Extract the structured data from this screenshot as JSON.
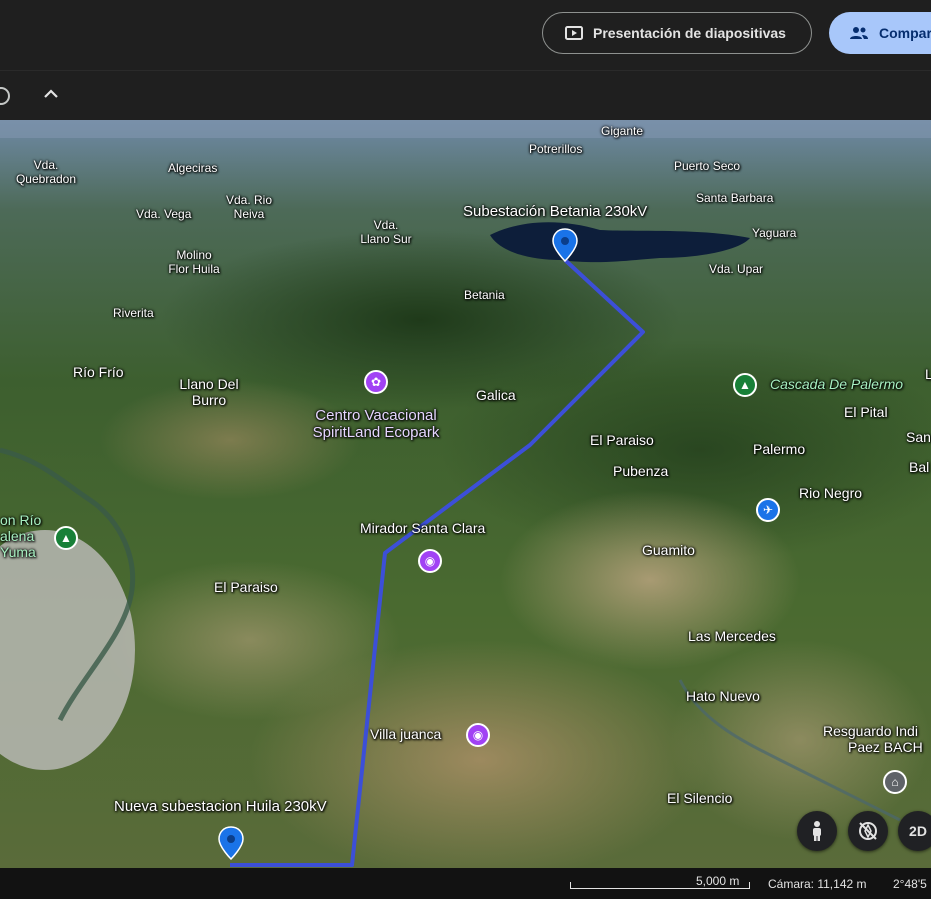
{
  "header": {
    "slideshow_label": "Presentación de diapositivas",
    "share_label": "Compar"
  },
  "map": {
    "route_color": "#3c4fd8",
    "places": {
      "gigante": "Gigante",
      "potrerillos": "Potrerillos",
      "puerto_seco": "Puerto Seco",
      "vda_quebradon_1": "Vda.",
      "vda_quebradon_2": "Quebradon",
      "algeciras": "Algeciras",
      "vda_vega": "Vda. Vega",
      "vda_rio_neiva_1": "Vda. Rio",
      "vda_rio_neiva_2": "Neiva",
      "vda_llano_sur_1": "Vda.",
      "vda_llano_sur_2": "Llano Sur",
      "santa_barbara": "Santa Barbara",
      "yaguara": "Yaguara",
      "molino_1": "Molino",
      "molino_2": "Flor Huila",
      "vda_upar": "Vda. Upar",
      "betania": "Betania",
      "riverita": "Riverita",
      "rio_frio": "Río Frío",
      "llano_del_burro_1": "Llano Del",
      "llano_del_burro_2": "Burro",
      "galica": "Galica",
      "el_pital": "El Pital",
      "el_paraiso_east": "El Paraiso",
      "pubenza": "Pubenza",
      "palermo": "Palermo",
      "rio_negro": "Rio Negro",
      "san_frag": "San",
      "bal_frag": "Bal",
      "guamito": "Guamito",
      "el_paraiso_west": "El Paraiso",
      "las_mercedes": "Las Mercedes",
      "hato_nuevo": "Hato Nuevo",
      "el_silencio": "El Silencio",
      "resguardo_1": "Resguardo Indi",
      "resguardo_2": "Paez BACH",
      "rio_frag_1": "on Río",
      "rio_frag_2": "alena",
      "rio_frag_3": "Yuma",
      "l_frag": "L"
    },
    "pins": {
      "betania_sub": "Subestación Betania 230kV",
      "huila_sub": "Nueva subestacion Huila 230kV"
    },
    "pois": {
      "spiritland_1": "Centro Vacacional",
      "spiritland_2": "SpiritLand Ecopark",
      "mirador": "Mirador Santa Clara",
      "villa_juanca": "Villa juanca",
      "cascada": "Cascada De Palermo"
    },
    "controls": {
      "view_2d": "2D"
    }
  },
  "status": {
    "scale": "5,000 m",
    "camera": "Cámara: 11,142 m",
    "coords": "2°48'5"
  }
}
